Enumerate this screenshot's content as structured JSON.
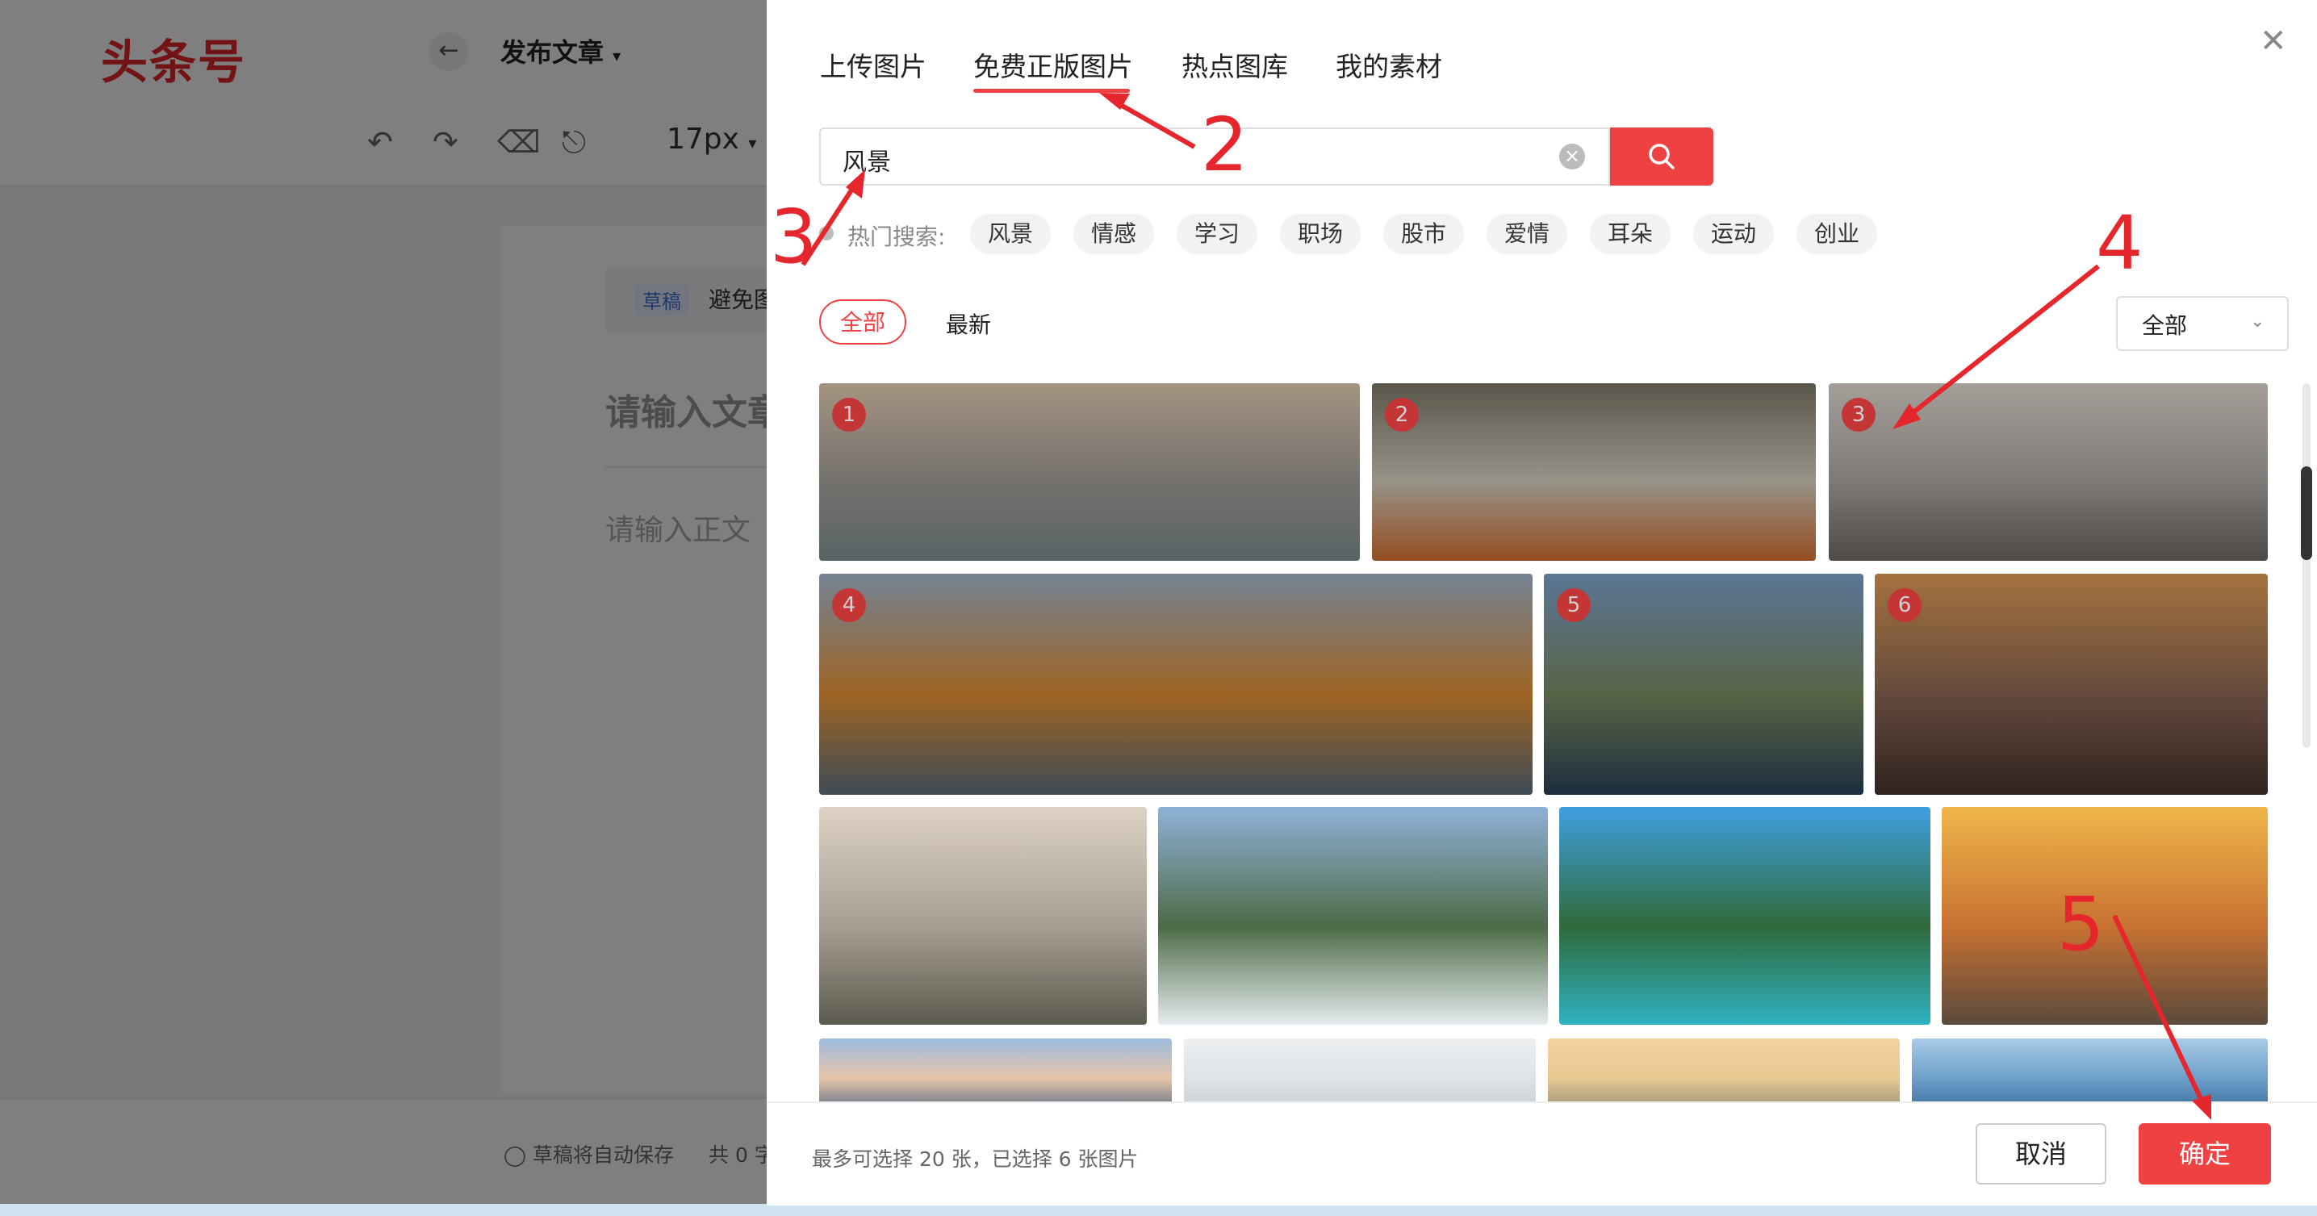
{
  "editor": {
    "logo": "头条号",
    "doc_title": "发布文章",
    "font_size": "17px",
    "draft_tag": "草稿",
    "draft_text": "避免图",
    "title_placeholder": "请输入文章",
    "body_placeholder": "请输入正文",
    "autosave": "草稿将自动保存",
    "word_count": "共 0 字"
  },
  "modal": {
    "tabs": [
      "上传图片",
      "免费正版图片",
      "热点图库",
      "我的素材"
    ],
    "active_tab": 1,
    "search": {
      "value": "风景"
    },
    "hot_search": {
      "label": "热门搜索:",
      "tags": [
        "风景",
        "情感",
        "学习",
        "职场",
        "股市",
        "爱情",
        "耳朵",
        "运动",
        "创业"
      ]
    },
    "filters": {
      "all": "全部",
      "latest": "最新"
    },
    "select": {
      "value": "全部"
    },
    "images": [
      {
        "badge": "1",
        "selected": true,
        "colors": [
          "#c9b49e",
          "#8f8b86",
          "#6d7a7c"
        ]
      },
      {
        "badge": "2",
        "selected": true,
        "colors": [
          "#6e6a5c",
          "#b9b3a6",
          "#b55f2a"
        ]
      },
      {
        "badge": "3",
        "selected": true,
        "colors": [
          "#c9c2bb",
          "#9a9591",
          "#5f5b59"
        ]
      },
      {
        "badge": "4",
        "selected": true,
        "colors": [
          "#8fa1b5",
          "#c27a2c",
          "#4d5d6a"
        ]
      },
      {
        "badge": "5",
        "selected": true,
        "colors": [
          "#6f90b6",
          "#6c7a56",
          "#23394d"
        ]
      },
      {
        "badge": "6",
        "selected": true,
        "colors": [
          "#c98c4d",
          "#7a5a4a",
          "#3b2b26"
        ]
      },
      {
        "badge": "",
        "selected": false,
        "colors": [
          "#ddd2c3",
          "#a79e93",
          "#5b5a4e"
        ]
      },
      {
        "badge": "",
        "selected": false,
        "colors": [
          "#8fb1d8",
          "#4d6b47",
          "#e6ecef"
        ]
      },
      {
        "badge": "",
        "selected": false,
        "colors": [
          "#3f9fe0",
          "#2f6a3a",
          "#2fb2c2"
        ]
      },
      {
        "badge": "",
        "selected": false,
        "colors": [
          "#f0b64a",
          "#c77132",
          "#5a4a3c"
        ]
      },
      {
        "badge": "",
        "selected": false,
        "colors": [
          "#9bbbe0",
          "#e7c5a8",
          "#5d6d86"
        ]
      },
      {
        "badge": "",
        "selected": false,
        "colors": [
          "#eceef0",
          "#dfe3e6",
          "#c9ced2"
        ]
      },
      {
        "badge": "",
        "selected": false,
        "colors": [
          "#f2d3a0",
          "#e7c891",
          "#9c8f7a"
        ]
      },
      {
        "badge": "",
        "selected": false,
        "colors": [
          "#a9cbe6",
          "#6c9fca",
          "#3d6f9e"
        ]
      }
    ],
    "footer_info": "最多可选择 20 张，已选择 6 张图片",
    "cancel_label": "取消",
    "confirm_label": "确定"
  },
  "annotations": [
    "2",
    "3",
    "4",
    "5"
  ],
  "colors": {
    "accent": "#f04142",
    "annotation": "#e5262c"
  }
}
